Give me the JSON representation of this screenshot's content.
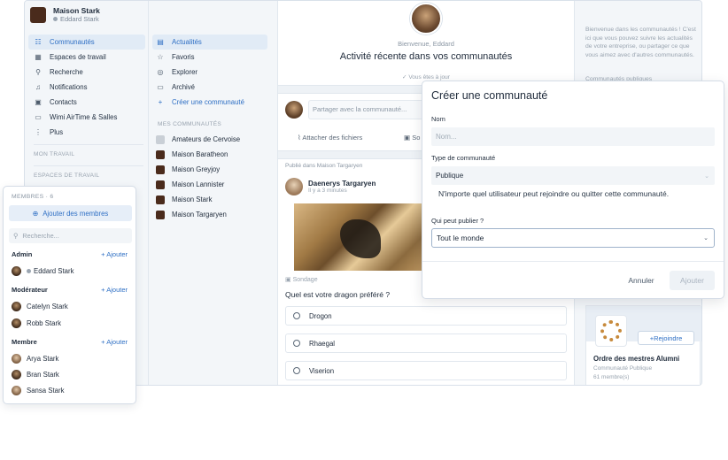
{
  "org": {
    "name": "Maison Stark",
    "user": "Eddard Stark"
  },
  "nav": [
    {
      "label": "Communautés",
      "icon": "community-icon"
    },
    {
      "label": "Espaces de travail",
      "icon": "workspace-icon"
    },
    {
      "label": "Recherche",
      "icon": "search-icon"
    },
    {
      "label": "Notifications",
      "icon": "bell-icon"
    },
    {
      "label": "Contacts",
      "icon": "contacts-icon"
    },
    {
      "label": "Wimi AirTime & Salles",
      "icon": "video-icon"
    },
    {
      "label": "Plus",
      "icon": "more-icon"
    }
  ],
  "sections": {
    "mon_travail": "MON TRAVAIL",
    "espaces": "ESPACES DE TRAVAIL",
    "mes_communautes": "MES COMMUNAUTÉS"
  },
  "nav2": [
    {
      "label": "Actualités",
      "icon": "news-icon"
    },
    {
      "label": "Favoris",
      "icon": "star-icon"
    },
    {
      "label": "Explorer",
      "icon": "compass-icon"
    },
    {
      "label": "Archivé",
      "icon": "archive-icon"
    },
    {
      "label": "Créer une communauté",
      "icon": "plus-icon"
    }
  ],
  "communities": [
    "Amateurs de Cervoise",
    "Maison Baratheon",
    "Maison Greyjoy",
    "Maison Lannister",
    "Maison Stark",
    "Maison Targaryen"
  ],
  "feed": {
    "welcome": "Bienvenue, Eddard",
    "title": "Activité récente dans vos communautés",
    "uptodate": "Vous êtes à jour",
    "composer_placeholder": "Partager avec la communauté...",
    "attach": "Attacher des fichiers",
    "attach2": "So",
    "posted_in": "Publié dans Maison Targaryen",
    "author": "Daenerys Targaryen",
    "ago": "Il y a 3 minutes",
    "sondage": "Sondage",
    "question": "Quel est votre dragon préféré ?",
    "options": [
      "Drogon",
      "Rhaegal",
      "Viserion"
    ]
  },
  "right": {
    "intro": "Bienvenue dans les communautés ! C'est ici que vous pouvez suivre les actualités de votre entreprise, ou partager ce que vous aimez avec d'autres communautés.",
    "intro2": "Communautés publiques",
    "join": "Rejoindre",
    "alumni_name": "Ordre des mestres Alumni",
    "alumni_type": "Communauté Publique",
    "alumni_count": "61 membre(s)"
  },
  "members": {
    "title": "MEMBRES · 6",
    "add": "Ajouter des membres",
    "search": "Recherche...",
    "add_short": "Ajouter",
    "roles": [
      {
        "name": "Admin",
        "people": [
          "Eddard Stark"
        ]
      },
      {
        "name": "Modérateur",
        "people": [
          "Catelyn Stark",
          "Robb Stark"
        ]
      },
      {
        "name": "Membre",
        "people": [
          "Arya Stark",
          "Bran Stark",
          "Sansa Stark"
        ]
      }
    ]
  },
  "dialog": {
    "title": "Créer une communauté",
    "name_label": "Nom",
    "name_placeholder": "Nom...",
    "type_label": "Type de communauté",
    "type_value": "Publique",
    "type_desc": "N'importe quel utilisateur peut rejoindre ou quitter cette communauté.",
    "who_label": "Qui peut publier ?",
    "who_value": "Tout le monde",
    "cancel": "Annuler",
    "add": "Ajouter"
  },
  "colors": {
    "accent": "#2e6fc4",
    "sidebar_bg": "#f3f6f9",
    "feed_bg": "#eef2f6"
  }
}
